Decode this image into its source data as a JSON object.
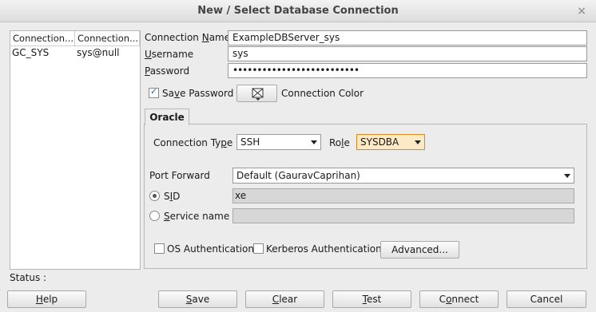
{
  "window": {
    "title": "New / Select Database Connection",
    "close_glyph": "×"
  },
  "connections": {
    "columns": [
      "Connection...",
      "Connection..."
    ],
    "rows": [
      {
        "name": "GC_SYS",
        "details": "sys@null"
      }
    ]
  },
  "form": {
    "connection_name_label": {
      "pre": "Connection ",
      "u": "N",
      "post": "ame"
    },
    "connection_name_value": "ExampleDBServer_sys",
    "username_label": {
      "pre": "",
      "u": "U",
      "post": "sername"
    },
    "username_value": "sys",
    "password_label": {
      "pre": "",
      "u": "P",
      "post": "assword"
    },
    "password_value": "••••••••••••••••••••••••••",
    "save_password_label": {
      "pre": "Sa",
      "u": "v",
      "post": "e Password"
    },
    "save_password_checked": true,
    "connection_color_label": "Connection Color"
  },
  "tab": {
    "label": "Oracle"
  },
  "oracle": {
    "connection_type_label": {
      "pre": "Connection Ty",
      "u": "p",
      "post": "e"
    },
    "connection_type_value": "SSH",
    "role_label": {
      "pre": "Ro",
      "u": "l",
      "post": "e"
    },
    "role_value": "SYSDBA",
    "port_forward_label": "Port Forward",
    "port_forward_value": "Default (GauravCaprihan)",
    "sid_label": {
      "pre": "S",
      "u": "I",
      "post": "D"
    },
    "sid_value": "xe",
    "sid_selected": true,
    "service_name_label": {
      "pre": "",
      "u": "S",
      "post": "ervice name"
    },
    "service_name_value": "",
    "os_auth_label": "OS Authentication",
    "kerberos_auth_label": "Kerberos Authentication",
    "advanced_label": "Advanced..."
  },
  "status": {
    "label": "Status :"
  },
  "buttons": {
    "help": {
      "u": "H",
      "post": "elp"
    },
    "save": {
      "u": "S",
      "post": "ave"
    },
    "clear": {
      "u": "C",
      "post": "lear"
    },
    "test": {
      "u": "T",
      "post": "est"
    },
    "connect": {
      "pre": "C",
      "u": "o",
      "post": "nnect"
    },
    "cancel": "Cancel"
  },
  "colors": {
    "title_bar": "#e5e5e5",
    "role_highlight": "#fde9c6",
    "role_border": "#d98b1f",
    "checkbox_tick": "#2a5fa8"
  }
}
